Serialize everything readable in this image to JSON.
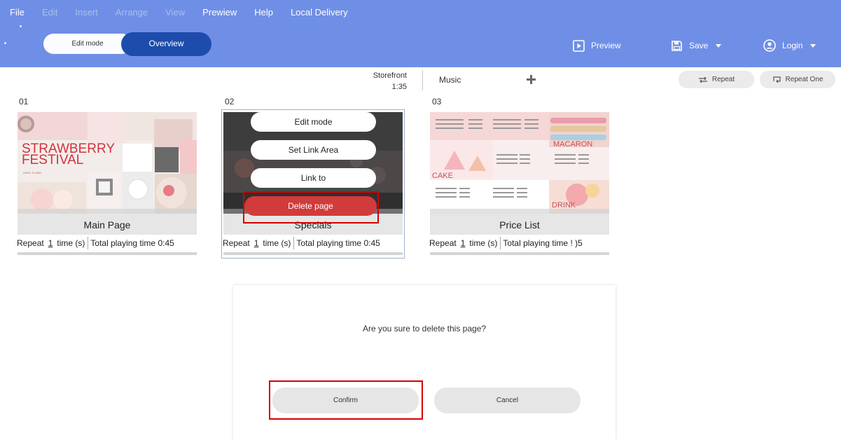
{
  "menu": {
    "file": "File",
    "edit": "Edit",
    "insert": "Insert",
    "arrange": "Arrange",
    "view": "View",
    "prewiew": "Prewiew",
    "help": "Help",
    "local_delivery": "Local Delivery"
  },
  "modes": {
    "edit": "Edit mode",
    "overview": "Overview",
    "active": "Overview"
  },
  "header": {
    "preview": "Preview",
    "save": "Save",
    "login": "Login"
  },
  "toolbar": {
    "storefront": "Storefront",
    "duration": "1:35",
    "music": "Music",
    "repeat": "Repeat",
    "repeat_one": "Repeat One"
  },
  "pages": [
    {
      "number": "01",
      "name": "Main Page",
      "repeat_prefix": "Repeat",
      "repeat_count": "1",
      "time_unit": "time (s)",
      "total_label": "Total playing time 0:45",
      "thumb_text": [
        "STRAWBERRY",
        "FESTIVAL",
        "UNTIL 31 MAY"
      ]
    },
    {
      "number": "02",
      "name": "Specials",
      "repeat_prefix": "Repeat",
      "repeat_count": "1",
      "time_unit": "time (s)",
      "total_label": "Total playing time 0:45"
    },
    {
      "number": "03",
      "name": "Price List",
      "repeat_prefix": "Repeat",
      "repeat_count": "1",
      "time_unit": "time (s)",
      "total_label": "Total playing time ! )5",
      "thumb_text": [
        "MACARON",
        "CAKE",
        "DRINK"
      ]
    }
  ],
  "context_menu": {
    "edit_mode": "Edit mode",
    "set_link_area": "Set Link Area",
    "link_to": "Link to",
    "delete_page": "Delete page"
  },
  "dialog": {
    "message": "Are you sure to delete this page?",
    "confirm": "Confirm",
    "cancel": "Cancel"
  },
  "colors": {
    "header_bg": "#6f8fe6",
    "overview_active": "#1e4cad",
    "delete_red": "#d23b3b",
    "highlight_box": "#d40000"
  },
  "icons": {
    "preview": "play-icon",
    "save": "save-disk-icon",
    "login": "user-circle-icon",
    "music_add": "plus-icon",
    "repeat": "repeat-arrows-icon",
    "repeat_one": "repeat-one-icon"
  }
}
